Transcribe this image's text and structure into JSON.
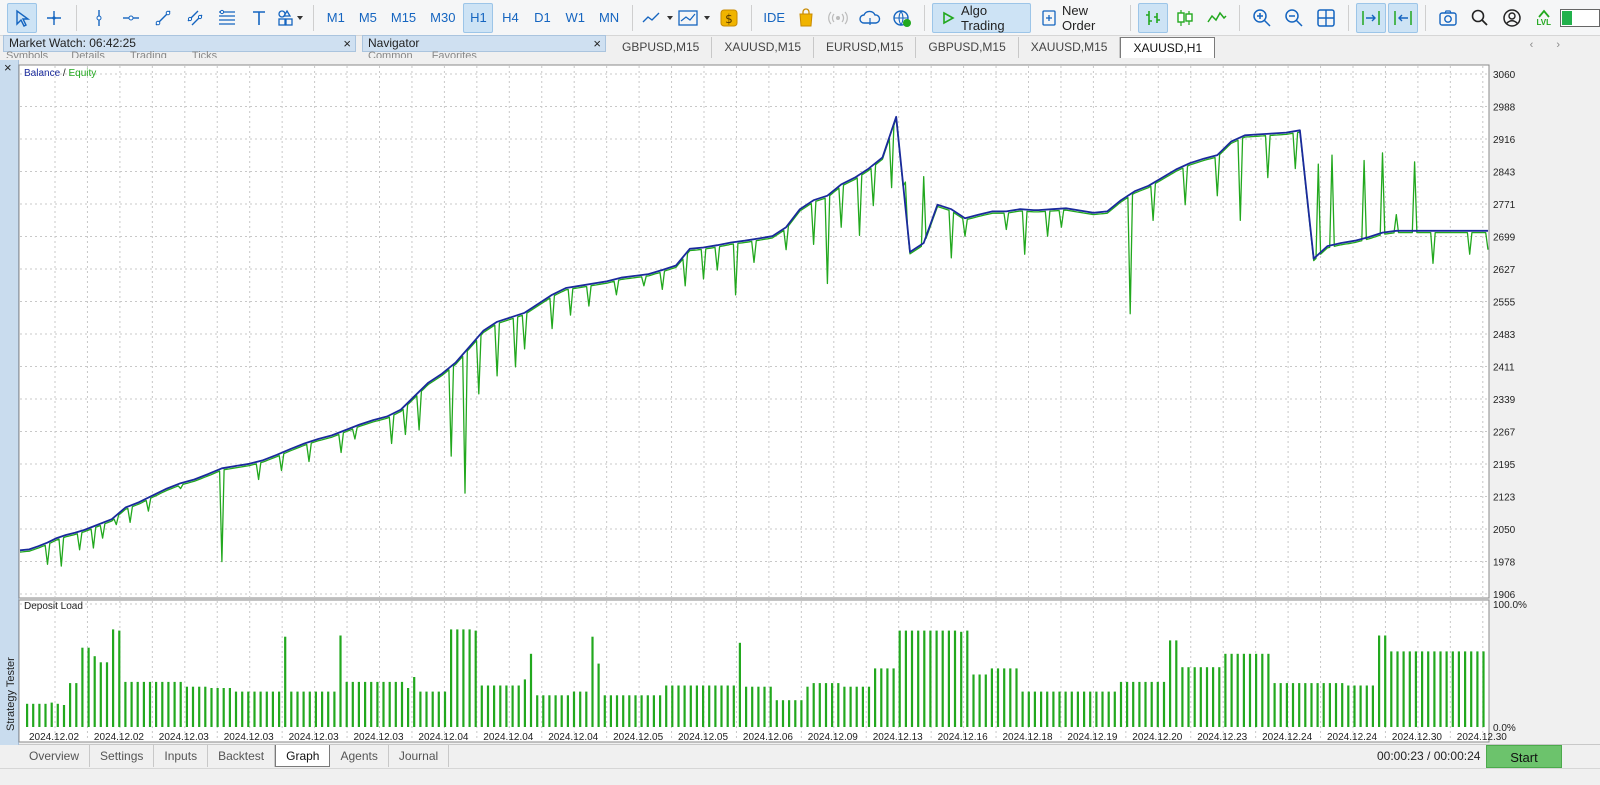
{
  "toolbar": {
    "timeframes": [
      "M1",
      "M5",
      "M15",
      "M30",
      "H1",
      "H4",
      "D1",
      "W1",
      "MN"
    ],
    "active_timeframe": "H1",
    "ide_label": "IDE",
    "algo_label": "Algo Trading",
    "order_label": "New Order",
    "lvl_label": "LVL",
    "lvl_fraction": 0.22
  },
  "panels": {
    "market_watch_title": "Market Watch: 06:42:25",
    "market_watch_tabs": [
      "Symbols",
      "Details",
      "Trading",
      "Ticks"
    ],
    "navigator_title": "Navigator",
    "navigator_tabs": [
      "Common",
      "Favorites"
    ],
    "close_glyph": "×"
  },
  "chart_tabs": [
    "GBPUSD,M15",
    "XAUUSD,M15",
    "EURUSD,M15",
    "GBPUSD,M15",
    "XAUUSD,M15",
    "XAUUSD,H1"
  ],
  "active_chart_tab": 5,
  "tab_arrows": "‹ ›",
  "side_panel_label": "Strategy Tester",
  "side_close": "×",
  "chart_data": [
    {
      "type": "line",
      "legend_parts": [
        {
          "text": "Balance",
          "color": "#1a2a9c"
        },
        {
          "text": " / ",
          "color": "#222222"
        },
        {
          "text": "Equity",
          "color": "#22a81e"
        }
      ],
      "y_ticks": [
        "3060",
        "2988",
        "2916",
        "2843",
        "2771",
        "2699",
        "2627",
        "2555",
        "2483",
        "2411",
        "2339",
        "2267",
        "2195",
        "2123",
        "2050",
        "1978",
        "1906"
      ],
      "ylim": [
        1906,
        3060
      ],
      "x_ticks": [
        "2024.12.02",
        "2024.12.02",
        "2024.12.03",
        "2024.12.03",
        "2024.12.03",
        "2024.12.03",
        "2024.12.04",
        "2024.12.04",
        "2024.12.04",
        "2024.12.05",
        "2024.12.05",
        "2024.12.06",
        "2024.12.09",
        "2024.12.13",
        "2024.12.16",
        "2024.12.18",
        "2024.12.19",
        "2024.12.20",
        "2024.12.23",
        "2024.12.24",
        "2024.12.24",
        "2024.12.30",
        "2024.12.30"
      ],
      "grid": true,
      "series": [
        {
          "name": "Balance",
          "color": "#1a2a9c",
          "x": [
            0,
            2,
            4,
            6,
            8,
            10,
            12,
            14,
            17,
            20,
            23,
            26,
            29,
            32,
            35,
            38,
            41,
            44,
            47,
            50,
            53,
            56,
            59,
            62,
            65,
            68,
            71,
            74,
            77,
            80,
            83,
            86,
            89,
            92,
            95,
            98,
            101,
            104,
            107,
            110,
            113,
            116,
            119,
            122,
            125,
            128,
            131,
            134,
            137,
            140,
            143,
            146,
            149,
            152,
            155,
            158,
            161,
            164,
            167,
            170,
            173,
            176,
            179,
            182,
            185,
            188,
            191,
            194,
            197,
            200,
            203,
            206,
            209,
            212,
            215,
            218,
            221,
            222,
            225,
            228,
            231,
            234,
            237,
            240,
            243,
            246,
            249,
            252,
            255,
            258,
            261,
            264,
            267,
            270,
            273,
            276,
            279,
            282,
            285,
            288,
            291,
            294,
            297,
            300
          ],
          "y": [
            2003,
            2005,
            2012,
            2020,
            2030,
            2037,
            2042,
            2048,
            2060,
            2072,
            2098,
            2110,
            2125,
            2140,
            2152,
            2160,
            2172,
            2185,
            2190,
            2195,
            2203,
            2215,
            2228,
            2240,
            2250,
            2258,
            2270,
            2282,
            2292,
            2300,
            2315,
            2345,
            2375,
            2395,
            2420,
            2455,
            2490,
            2510,
            2520,
            2530,
            2550,
            2570,
            2585,
            2590,
            2595,
            2600,
            2608,
            2612,
            2616,
            2625,
            2635,
            2672,
            2675,
            2680,
            2686,
            2690,
            2695,
            2700,
            2720,
            2760,
            2780,
            2790,
            2815,
            2830,
            2850,
            2875,
            2965,
            2665,
            2685,
            2770,
            2760,
            2740,
            2748,
            2755,
            2755,
            2760,
            2758,
            2758,
            2760,
            2762,
            2757,
            2752,
            2755,
            2780,
            2800,
            2812,
            2830,
            2848,
            2862,
            2872,
            2880,
            2910,
            2924,
            2926,
            2928,
            2930,
            2935,
            2650,
            2678,
            2685,
            2690,
            2698,
            2708,
            2712
          ]
        },
        {
          "name": "Equity",
          "color": "#22a81e",
          "spikes": [
            [
              6,
              1972
            ],
            [
              9,
              1968
            ],
            [
              13,
              2004
            ],
            [
              16,
              2008
            ],
            [
              18,
              2030
            ],
            [
              21,
              2060
            ],
            [
              24,
              2065
            ],
            [
              28,
              2090
            ],
            [
              35,
              2140
            ],
            [
              44,
              1978
            ],
            [
              52,
              2160
            ],
            [
              57,
              2180
            ],
            [
              63,
              2200
            ],
            [
              70,
              2220
            ],
            [
              73,
              2250
            ],
            [
              81,
              2240
            ],
            [
              84,
              2260
            ],
            [
              87,
              2270
            ],
            [
              94,
              2212
            ],
            [
              97,
              2130
            ],
            [
              100,
              2350
            ],
            [
              104,
              2390
            ],
            [
              108,
              2410
            ],
            [
              110,
              2450
            ],
            [
              116,
              2495
            ],
            [
              120,
              2525
            ],
            [
              124,
              2545
            ],
            [
              130,
              2570
            ],
            [
              136,
              2590
            ],
            [
              140,
              2582
            ],
            [
              145,
              2590
            ],
            [
              149,
              2605
            ],
            [
              152,
              2625
            ],
            [
              156,
              2570
            ],
            [
              160,
              2642
            ],
            [
              167,
              2670
            ],
            [
              173,
              2682
            ],
            [
              176,
              2595
            ],
            [
              179,
              2720
            ],
            [
              183,
              2702
            ],
            [
              186,
              2768
            ],
            [
              190,
              2808
            ],
            [
              193,
              2820
            ],
            [
              197,
              2832
            ],
            [
              203,
              2652
            ],
            [
              206,
              2700
            ],
            [
              215,
              2715
            ],
            [
              219,
              2660
            ],
            [
              224,
              2700
            ],
            [
              227,
              2720
            ],
            [
              242,
              2528
            ],
            [
              247,
              2735
            ],
            [
              254,
              2770
            ],
            [
              261,
              2790
            ],
            [
              266,
              2735
            ],
            [
              272,
              2830
            ],
            [
              278,
              2850
            ],
            [
              283,
              2860
            ],
            [
              286,
              2880
            ],
            [
              293,
              2868
            ],
            [
              297,
              2885
            ],
            [
              300,
              2748
            ],
            [
              304,
              2865
            ],
            [
              308,
              2640
            ],
            [
              316,
              2660
            ],
            [
              320,
              2670
            ]
          ]
        }
      ]
    },
    {
      "type": "bar",
      "title": "Deposit Load",
      "y_ticks": [
        "100.0%",
        "0.0%"
      ],
      "ylim": [
        0,
        100
      ],
      "values": [
        19,
        19,
        19,
        19,
        20,
        19,
        18,
        36,
        36,
        65,
        65,
        58,
        53,
        53,
        80,
        79,
        37,
        37,
        37,
        37,
        37,
        37,
        37,
        37,
        37,
        37,
        33,
        33,
        33,
        33,
        32,
        32,
        32,
        32,
        29,
        29,
        29,
        29,
        29,
        29,
        29,
        29,
        74,
        29,
        29,
        29,
        29,
        29,
        29,
        29,
        29,
        75,
        37,
        37,
        37,
        37,
        37,
        37,
        37,
        37,
        37,
        37,
        32,
        41,
        29,
        29,
        29,
        29,
        29,
        80,
        80,
        80,
        80,
        79,
        34,
        34,
        34,
        34,
        34,
        34,
        34,
        39,
        60,
        26,
        26,
        26,
        26,
        26,
        26,
        29,
        29,
        29,
        74,
        52,
        26,
        26,
        26,
        26,
        26,
        26,
        26,
        26,
        26,
        26,
        34,
        34,
        34,
        34,
        34,
        34,
        34,
        34,
        34,
        34,
        34,
        34,
        69,
        33,
        33,
        33,
        33,
        33,
        22,
        22,
        22,
        22,
        22,
        33,
        36,
        36,
        36,
        36,
        36,
        33,
        33,
        33,
        33,
        33,
        48,
        48,
        48,
        48,
        79,
        79,
        79,
        79,
        79,
        79,
        79,
        79,
        79,
        79,
        78,
        79,
        43,
        43,
        43,
        48,
        48,
        48,
        48,
        48,
        29,
        29,
        29,
        29,
        29,
        29,
        29,
        29,
        29,
        29,
        29,
        29,
        29,
        29,
        29,
        29,
        37,
        37,
        37,
        37,
        37,
        37,
        37,
        37,
        71,
        71,
        49,
        49,
        49,
        49,
        49,
        49,
        49,
        60,
        60,
        60,
        60,
        60,
        60,
        60,
        60,
        36,
        36,
        36,
        36,
        36,
        36,
        36,
        36,
        36,
        36,
        36,
        36,
        34,
        34,
        34,
        34,
        34,
        75,
        75,
        62,
        62,
        62,
        62,
        62,
        62,
        62,
        62,
        62,
        62,
        62,
        62,
        62,
        62,
        62,
        62,
        62,
        62,
        62
      ]
    }
  ],
  "bottom_tabs": [
    "Overview",
    "Settings",
    "Inputs",
    "Backtest",
    "Graph",
    "Agents",
    "Journal"
  ],
  "active_bottom_tab": 4,
  "timer_text": "00:00:23 / 00:00:24",
  "start_label": "Start",
  "colors": {
    "grid": "#c8c8c8",
    "bars": "#22a81e",
    "accent": "#1565c0",
    "start": "#6cc36c"
  }
}
